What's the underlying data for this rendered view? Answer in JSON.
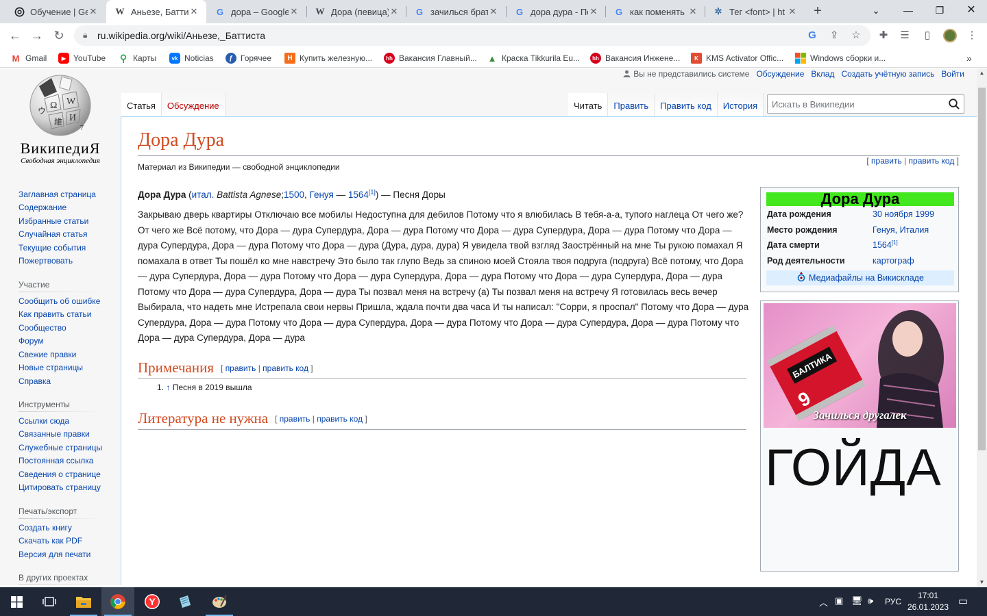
{
  "browser": {
    "tabs": [
      {
        "title": "Обучение | Ge",
        "favicon": "openai-icon"
      },
      {
        "title": "Аньезе, Баттис",
        "favicon": "wikipedia-icon"
      },
      {
        "title": "дора – Google",
        "favicon": "google-icon"
      },
      {
        "title": "Дора (певица)",
        "favicon": "wikipedia-icon"
      },
      {
        "title": "зачилься брату",
        "favicon": "google-icon"
      },
      {
        "title": "дора дура - По",
        "favicon": "google-icon"
      },
      {
        "title": "как поменять ц",
        "favicon": "google-icon"
      },
      {
        "title": "Тег <font> | ht",
        "favicon": "htmlbook-icon"
      }
    ],
    "url": "ru.wikipedia.org/wiki/Аньезе,_Баттиста",
    "bookmarks": [
      {
        "label": "Gmail",
        "icon": "gmail-icon"
      },
      {
        "label": "YouTube",
        "icon": "youtube-icon"
      },
      {
        "label": "Карты",
        "icon": "maps-icon"
      },
      {
        "label": "Noticias",
        "icon": "vk-icon"
      },
      {
        "label": "Горячее",
        "icon": "pikabu-icon"
      },
      {
        "label": "Купить железную...",
        "icon": "leroy-icon"
      },
      {
        "label": "Вакансия Главный...",
        "icon": "hh-icon"
      },
      {
        "label": "Краска Tikkurila Eu...",
        "icon": "mountain-icon"
      },
      {
        "label": "Вакансия Инжене...",
        "icon": "hh-icon"
      },
      {
        "label": "KMS Activator Offic...",
        "icon": "kms-icon"
      },
      {
        "label": "Windows сборки и...",
        "icon": "windows-icon"
      }
    ]
  },
  "wiki": {
    "logo_wordmark": "ВикипедиЯ",
    "logo_tagline": "Свободная энциклопедия",
    "personal": {
      "user": "Вы не представились системе",
      "links": [
        "Обсуждение",
        "Вклад",
        "Создать учётную запись",
        "Войти"
      ]
    },
    "tabs_left": [
      "Статья",
      "Обсуждение"
    ],
    "tabs_right": [
      "Читать",
      "Править",
      "Править код",
      "История"
    ],
    "search_placeholder": "Искать в Википедии",
    "sidebar": {
      "main": [
        "Заглавная страница",
        "Содержание",
        "Избранные статьи",
        "Случайная статья",
        "Текущие события",
        "Пожертвовать"
      ],
      "participation_head": "Участие",
      "participation": [
        "Сообщить об ошибке",
        "Как править статьи",
        "Сообщество",
        "Форум",
        "Свежие правки",
        "Новые страницы",
        "Справка"
      ],
      "tools_head": "Инструменты",
      "tools": [
        "Ссылки сюда",
        "Связанные правки",
        "Служебные страницы",
        "Постоянная ссылка",
        "Сведения о странице",
        "Цитировать страницу"
      ],
      "print_head": "Печать/экспорт",
      "print": [
        "Создать книгу",
        "Скачать как PDF",
        "Версия для печати"
      ],
      "other_head": "В других проектах"
    },
    "article": {
      "title": "Дора Дура",
      "site_sub": "Материал из Википедии — свободной энциклопедии",
      "edit_links": [
        "править",
        "править код"
      ],
      "lead": {
        "bold_name": "Дора Дура",
        "ital_abbr": "итал.",
        "ital_name": "Battista Agnese",
        "birth_year": "1500",
        "birth_place": "Генуя",
        "death_year": "1564",
        "ref": "[1]",
        "tail": "— Песня Доры"
      },
      "lyrics": "Закрываю дверь квартиры Отключаю все мобилы Недоступна для дебилов Потому что я влюбилась В тебя-а-а, тупого наглеца От чего же? От чего же Всё потому, что Дора — дура Супердура, Дора — дура Потому что Дора — дура Супердура, Дора — дура Потому что Дора — дура Супердура, Дора — дура Потому что Дора — дура (Дура, дура, дура) Я увидела твой взгляд Заострённый на мне Ты рукою помахал Я помахала в ответ Ты пошёл ко мне навстречу Это было так глупо Ведь за спиною моей Стояла твоя подруга (подруга) Всё потому, что Дора — дура Супердура, Дора — дура Потому что Дора — дура Супердура, Дора — дура Потому что Дора — дура Супердура, Дора — дура Потому что Дора — дура Супердура, Дора — дура Ты позвал меня на встречу (а) Ты позвал меня на встречу Я готовилась весь вечер Выбирала, что надеть мне Истрепала свои нервы Пришла, ждала почти два часа И ты написал: \"Сорри, я проспал\" Потому что Дора — дура Супердура, Дора — дура Потому что Дора — дура Супердура, Дора — дура Потому что Дора — дура Супердура, Дора — дура Потому что Дора — дура Супердура, Дора — дура",
      "notes_heading": "Примечания",
      "ref_num": "1.",
      "ref_arrow": "↑",
      "ref_text": "Песня в 2019 вышла",
      "lit_heading": "Литература не нужна"
    },
    "infobox": {
      "title": "Дора Дура",
      "title_bg": "#42e81d",
      "rows": [
        {
          "label": "Дата рождения",
          "value": "30 ноября 1999"
        },
        {
          "label": "Место рождения",
          "value": "Генуя, Италия"
        },
        {
          "label": "Дата смерти",
          "value": "1564",
          "sup": "[1]"
        },
        {
          "label": "Род деятельности",
          "value": "картограф"
        }
      ],
      "commons": "Медиафайлы на Викискладе"
    },
    "image_box": {
      "poster_caption": "Зачилься другалек",
      "big_text": "ГОЙДА"
    }
  },
  "taskbar": {
    "lang": "РУС",
    "time": "17:01",
    "date": "26.01.2023"
  }
}
